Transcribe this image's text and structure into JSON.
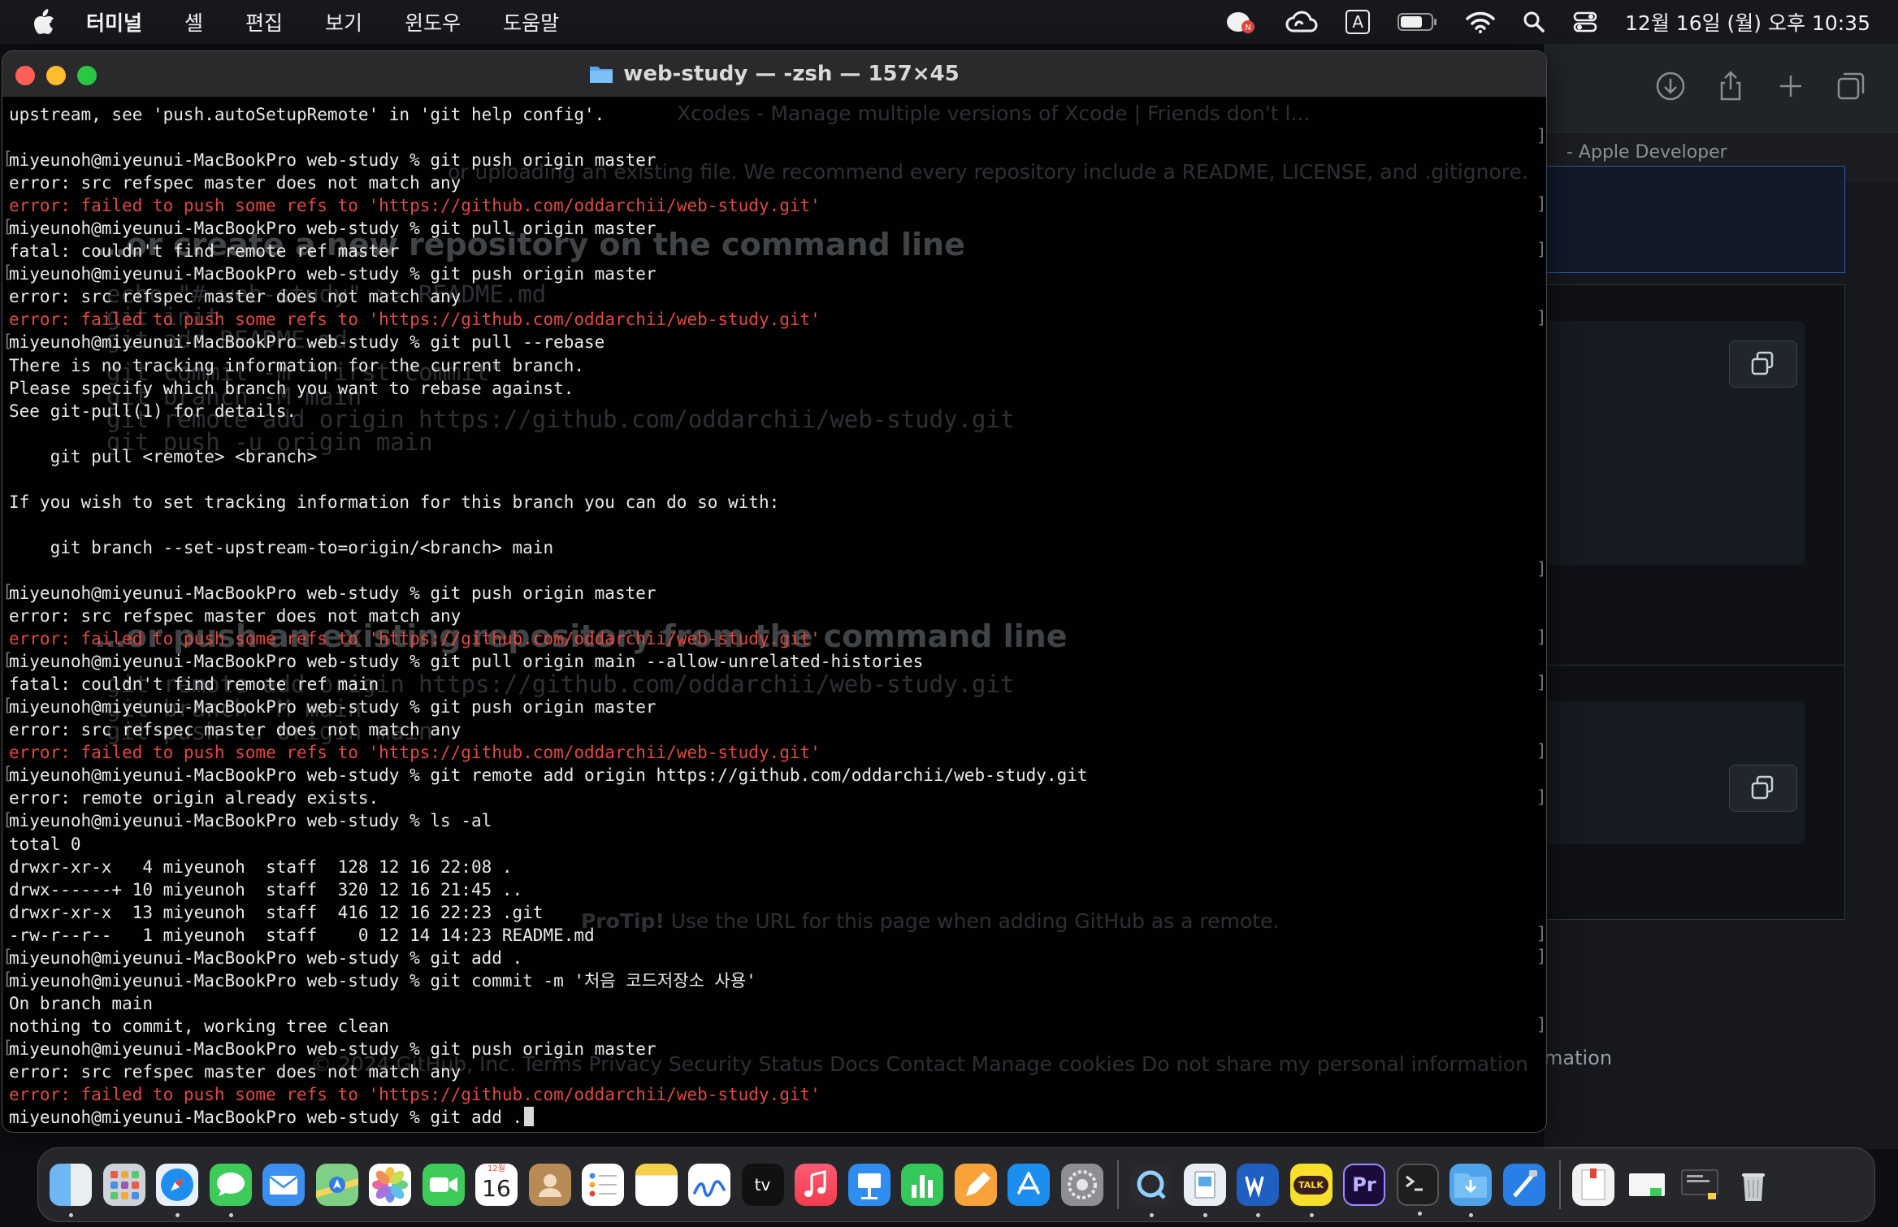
{
  "menubar": {
    "items": [
      "터미널",
      "셸",
      "편집",
      "보기",
      "윈도우",
      "도움말"
    ],
    "input_indicator": "A",
    "clock": "12월 16일 (월) 오후 10:35",
    "icons": [
      "apple-icon",
      "notification-app-icon",
      "creative-cloud-icon",
      "input-source-icon",
      "battery-icon",
      "wifi-icon",
      "spotlight-search-icon",
      "control-center-icon"
    ]
  },
  "terminal": {
    "title": "web-study — -zsh — 157×45",
    "lines": [
      {
        "text": "upstream, see 'push.autoSetupRemote' in 'git help config'.",
        "type": "out"
      },
      {
        "text": "",
        "type": "out"
      },
      {
        "text": "miyeunoh@miyeunui-MacBookPro web-study % git push origin master",
        "type": "prompt"
      },
      {
        "text": "error: src refspec master does not match any",
        "type": "out"
      },
      {
        "text": "error: failed to push some refs to 'https://github.com/oddarchii/web-study.git'",
        "type": "err"
      },
      {
        "text": "miyeunoh@miyeunui-MacBookPro web-study % git pull origin master",
        "type": "prompt"
      },
      {
        "text": "fatal: couldn't find remote ref master",
        "type": "out"
      },
      {
        "text": "miyeunoh@miyeunui-MacBookPro web-study % git push origin master",
        "type": "prompt"
      },
      {
        "text": "error: src refspec master does not match any",
        "type": "out"
      },
      {
        "text": "error: failed to push some refs to 'https://github.com/oddarchii/web-study.git'",
        "type": "err"
      },
      {
        "text": "miyeunoh@miyeunui-MacBookPro web-study % git pull --rebase",
        "type": "prompt"
      },
      {
        "text": "There is no tracking information for the current branch.",
        "type": "out"
      },
      {
        "text": "Please specify which branch you want to rebase against.",
        "type": "out"
      },
      {
        "text": "See git-pull(1) for details.",
        "type": "out"
      },
      {
        "text": "",
        "type": "out"
      },
      {
        "text": "    git pull <remote> <branch>",
        "type": "out"
      },
      {
        "text": "",
        "type": "out"
      },
      {
        "text": "If you wish to set tracking information for this branch you can do so with:",
        "type": "out"
      },
      {
        "text": "",
        "type": "out"
      },
      {
        "text": "    git branch --set-upstream-to=origin/<branch> main",
        "type": "out"
      },
      {
        "text": "",
        "type": "out"
      },
      {
        "text": "miyeunoh@miyeunui-MacBookPro web-study % git push origin master",
        "type": "prompt"
      },
      {
        "text": "error: src refspec master does not match any",
        "type": "out"
      },
      {
        "text": "error: failed to push some refs to 'https://github.com/oddarchii/web-study.git'",
        "type": "err"
      },
      {
        "text": "miyeunoh@miyeunui-MacBookPro web-study % git pull origin main --allow-unrelated-histories",
        "type": "prompt"
      },
      {
        "text": "fatal: couldn't find remote ref main",
        "type": "out"
      },
      {
        "text": "miyeunoh@miyeunui-MacBookPro web-study % git push origin master",
        "type": "prompt"
      },
      {
        "text": "error: src refspec master does not match any",
        "type": "out"
      },
      {
        "text": "error: failed to push some refs to 'https://github.com/oddarchii/web-study.git'",
        "type": "err"
      },
      {
        "text": "miyeunoh@miyeunui-MacBookPro web-study % git remote add origin https://github.com/oddarchii/web-study.git",
        "type": "prompt"
      },
      {
        "text": "error: remote origin already exists.",
        "type": "out"
      },
      {
        "text": "miyeunoh@miyeunui-MacBookPro web-study % ls -al",
        "type": "prompt"
      },
      {
        "text": "total 0",
        "type": "out"
      },
      {
        "text": "drwxr-xr-x   4 miyeunoh  staff  128 12 16 22:08 .",
        "type": "out"
      },
      {
        "text": "drwx------+ 10 miyeunoh  staff  320 12 16 21:45 ..",
        "type": "out"
      },
      {
        "text": "drwxr-xr-x  13 miyeunoh  staff  416 12 16 22:23 .git",
        "type": "out"
      },
      {
        "text": "-rw-r--r--   1 miyeunoh  staff    0 12 14 14:23 README.md",
        "type": "out"
      },
      {
        "text": "miyeunoh@miyeunui-MacBookPro web-study % git add .",
        "type": "prompt"
      },
      {
        "text": "miyeunoh@miyeunui-MacBookPro web-study % git commit -m '처음 코드저장소 사용'",
        "type": "prompt"
      },
      {
        "text": "On branch main",
        "type": "out"
      },
      {
        "text": "nothing to commit, working tree clean",
        "type": "out"
      },
      {
        "text": "miyeunoh@miyeunui-MacBookPro web-study % git push origin master",
        "type": "prompt"
      },
      {
        "text": "error: src refspec master does not match any",
        "type": "out"
      },
      {
        "text": "error: failed to push some refs to 'https://github.com/oddarchii/web-study.git'",
        "type": "err"
      },
      {
        "text": "miyeunoh@miyeunui-MacBookPro web-study % git add .",
        "type": "current"
      }
    ]
  },
  "browser": {
    "tab_text": "- Apple Developer",
    "footer_tail": "mation",
    "toolbar_icons": [
      "download-icon",
      "share-icon",
      "new-tab-icon",
      "tab-overview-icon"
    ]
  },
  "background_page": {
    "intro": "or uploading an existing file. We recommend every repository include a README, LICENSE, and .gitignore.",
    "tab_ghost": "Xcodes - Manage multiple versions of Xcode | Friends don't l...",
    "heading1": "…or create a new repository on the command line",
    "code1": [
      "echo \"# web-study\" >> README.md",
      "git init",
      "git add README.md",
      "git commit -m \"first commit\"",
      "git branch -M main",
      "git remote add origin https://github.com/oddarchii/web-study.git",
      "git push -u origin main"
    ],
    "heading2": "…or push an existing repository from the command line",
    "code2": [
      "git remote add origin https://github.com/oddarchii/web-study.git",
      "git branch -M main",
      "git push -u origin main"
    ],
    "protip_label": "ProTip!",
    "protip_text": "Use the URL for this page when adding GitHub as a remote.",
    "footer": "© 2024 GitHub, Inc.   Terms   Privacy   Security   Status   Docs   Contact   Manage cookies   Do not share my personal information"
  },
  "dock": {
    "apps": [
      "finder-icon",
      "launchpad-icon",
      "safari-icon",
      "messages-icon",
      "mail-icon",
      "maps-icon",
      "photos-icon",
      "facetime-icon",
      "calendar-icon",
      "contacts-icon",
      "reminders-icon",
      "notes-icon",
      "freeform-icon",
      "apple-tv-icon",
      "music-icon",
      "keynote-icon",
      "numbers-icon",
      "pages-icon",
      "app-store-icon",
      "system-settings-icon",
      "quicktime-icon",
      "preview-icon",
      "word-icon",
      "kakaotalk-icon",
      "premiere-icon",
      "terminal-icon",
      "downloads-folder-icon",
      "xcode-icon",
      "documents-stack-icon",
      "screenshot-stack-icon",
      "desktop-stack-icon",
      "trash-icon"
    ],
    "calendar_month": "12월",
    "calendar_day": "16",
    "appletv_label": "tv",
    "kakaotalk_label": "TALK",
    "premiere_label": "Pr"
  }
}
